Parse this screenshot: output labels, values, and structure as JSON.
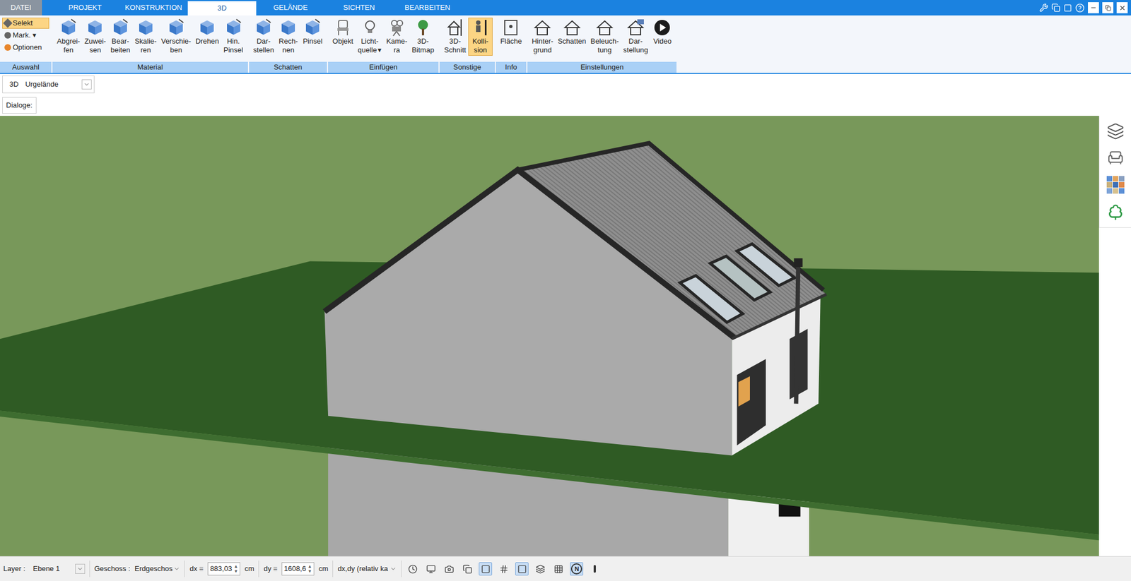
{
  "tabs": [
    {
      "label": "DATEI",
      "selected": false
    },
    {
      "label": "PROJEKT",
      "selected": false
    },
    {
      "label": "KONSTRUKTION",
      "selected": false
    },
    {
      "label": "3D",
      "selected": true
    },
    {
      "label": "GELÄNDE",
      "selected": false
    },
    {
      "label": "SICHTEN",
      "selected": false
    },
    {
      "label": "BEARBEITEN",
      "selected": false
    }
  ],
  "ribbon": {
    "selection": {
      "label": "Auswahl",
      "items": [
        {
          "label": "Selekt",
          "suffix": "",
          "selected": true
        },
        {
          "label": "Mark.",
          "suffix": "▾",
          "selected": false
        },
        {
          "label": "Optionen",
          "suffix": "",
          "selected": false
        }
      ]
    },
    "groups": [
      {
        "label": "Material",
        "buttons": [
          {
            "lines": [
              "Abgrei-",
              "fen"
            ],
            "suffix": "",
            "selected": false
          },
          {
            "lines": [
              "Zuwei-",
              "sen"
            ],
            "suffix": "",
            "selected": false
          },
          {
            "lines": [
              "Bear-",
              "beiten"
            ],
            "suffix": "",
            "selected": false
          },
          {
            "lines": [
              "Skalie-",
              "ren"
            ],
            "suffix": "",
            "selected": false
          },
          {
            "lines": [
              "Verschie-",
              "ben"
            ],
            "suffix": "",
            "selected": false
          },
          {
            "lines": [
              "Drehen"
            ],
            "suffix": "",
            "selected": false
          },
          {
            "lines": [
              "Hin.",
              "Pinsel"
            ],
            "suffix": "",
            "selected": false
          }
        ]
      },
      {
        "label": "Schatten",
        "buttons": [
          {
            "lines": [
              "Dar-",
              "stellen"
            ],
            "suffix": "",
            "selected": false
          },
          {
            "lines": [
              "Rech-",
              "nen"
            ],
            "suffix": "",
            "selected": false
          },
          {
            "lines": [
              "Pinsel"
            ],
            "suffix": "",
            "selected": false
          }
        ]
      },
      {
        "label": "Einfügen",
        "buttons": [
          {
            "lines": [
              "Objekt"
            ],
            "suffix": "",
            "selected": false
          },
          {
            "lines": [
              "Licht-",
              "quelle"
            ],
            "suffix": "▾",
            "selected": false
          },
          {
            "lines": [
              "Kame-",
              "ra"
            ],
            "suffix": "",
            "selected": false
          },
          {
            "lines": [
              "3D-",
              "Bitmap"
            ],
            "suffix": "",
            "selected": false
          }
        ]
      },
      {
        "label": "Sonstige",
        "buttons": [
          {
            "lines": [
              "3D-",
              "Schnitt"
            ],
            "suffix": "",
            "selected": false
          },
          {
            "lines": [
              "Kolli-",
              "sion"
            ],
            "suffix": "",
            "selected": true
          }
        ]
      },
      {
        "label": "Info",
        "buttons": [
          {
            "lines": [
              "Fläche"
            ],
            "suffix": "",
            "selected": false
          }
        ]
      },
      {
        "label": "Einstellungen",
        "buttons": [
          {
            "lines": [
              "Hinter-",
              "grund"
            ],
            "suffix": "",
            "selected": false
          },
          {
            "lines": [
              "Schatten"
            ],
            "suffix": "",
            "selected": false
          },
          {
            "lines": [
              "Beleuch-",
              "tung"
            ],
            "suffix": "",
            "selected": false
          },
          {
            "lines": [
              "Dar-",
              "stellung"
            ],
            "suffix": "",
            "selected": false
          },
          {
            "lines": [
              "Video"
            ],
            "suffix": "",
            "selected": false
          }
        ]
      }
    ]
  },
  "view": {
    "prefix": "3D",
    "value": "Urgelände"
  },
  "dialogs": {
    "label": "Dialoge:"
  },
  "status_bar": {
    "layer": {
      "label": "Layer :",
      "value": "Ebene 1"
    },
    "floor": {
      "label": "Geschoss :",
      "value": "Erdgeschos"
    },
    "dx": {
      "label": "dx =",
      "value": "883,03",
      "unit": "cm"
    },
    "dy": {
      "label": "dy =",
      "value": "1608,6",
      "unit": "cm"
    },
    "mode": {
      "value": "dx,dy (relativ ka"
    },
    "tools": [
      {
        "label": "",
        "active": false
      },
      {
        "label": "",
        "active": false
      },
      {
        "label": "",
        "active": false
      },
      {
        "label": "",
        "active": false
      },
      {
        "label": "",
        "active": true
      },
      {
        "label": "",
        "active": false
      },
      {
        "label": "",
        "active": true
      },
      {
        "label": "",
        "active": false
      },
      {
        "label": "",
        "active": false
      },
      {
        "label": "N",
        "active": true
      },
      {
        "label": "",
        "active": false
      }
    ]
  }
}
